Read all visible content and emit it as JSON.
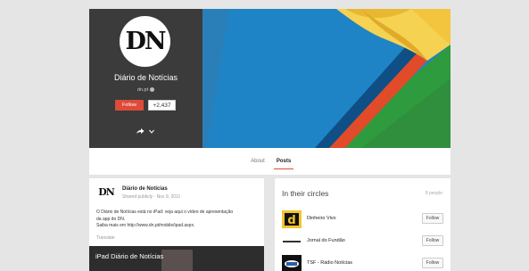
{
  "profile": {
    "logo_text": "DN",
    "name": "Diário de Notícias",
    "url": "dn.pt",
    "follow_label": "Follow",
    "follower_count": "+2,437"
  },
  "tabs": [
    {
      "label": "About"
    },
    {
      "label": "Posts"
    }
  ],
  "post": {
    "avatar_text": "DN",
    "author": "Diário de Notícias",
    "meta": "Shared publicly · Nov 9, 2011",
    "text_lines": [
      "O Diário de Notícias está no iPad: veja aqui o vídeo de apresentação",
      "da app do DN.",
      "Saiba mais em http://www.dn.pt/mobile/ipad.aspx."
    ],
    "translate_label": "Translate",
    "video_title": "iPad Diário de Notícias"
  },
  "circles": {
    "title": "In their circles",
    "count": "8 people",
    "items": [
      {
        "name": "Dinheiro Vivo",
        "follow_label": "Follow"
      },
      {
        "name": "Jornal do Fundão",
        "follow_label": "Follow"
      },
      {
        "name": "TSF - Rádio Notícias",
        "follow_label": "Follow"
      }
    ]
  },
  "colors": {
    "accent": "#dd4b39",
    "panel": "#3b3b3b",
    "background": "#e5e5e5"
  },
  "icons": [
    "verified-icon",
    "share-icon",
    "chevron-down-icon"
  ]
}
